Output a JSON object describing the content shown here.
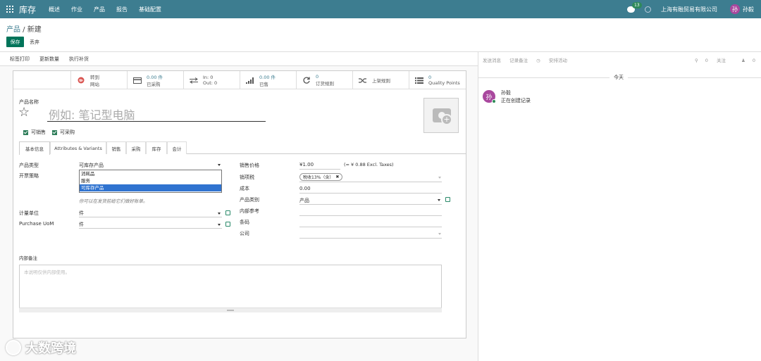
{
  "nav": {
    "brand": "库存",
    "menus": [
      "概述",
      "作业",
      "产品",
      "报告",
      "基础配置"
    ],
    "chat_badge": "13",
    "company": "上海有融贸易有限公司",
    "avatar_initial": "孙",
    "user": "孙毅"
  },
  "control": {
    "breadcrumb_parent": "产品",
    "breadcrumb_sep": " / ",
    "breadcrumb_current": "新建",
    "save": "保存",
    "discard": "丢弃"
  },
  "actions": [
    "标签打印",
    "更新数量",
    "执行补货"
  ],
  "smart_buttons": [
    {
      "line1": "转到",
      "line2": "网站",
      "icon": "globe-icon"
    },
    {
      "line1": "0.00 件",
      "line2": "已采购",
      "icon": "credit-card-icon"
    },
    {
      "line1": "In:  0",
      "line2": "Out:  0",
      "icon": "exchange-icon"
    },
    {
      "line1": "0.00 件",
      "line2": "已售",
      "icon": "signal-icon"
    },
    {
      "line1": "0",
      "line2": "订货规则",
      "icon": "refresh-icon"
    },
    {
      "line1": "上架规则",
      "line2": "",
      "icon": "random-icon"
    },
    {
      "line1": "0",
      "line2": "Quality Points",
      "icon": "list-icon"
    }
  ],
  "form": {
    "name_label": "产品名称",
    "name_placeholder": "例如: 笔记型电脑",
    "can_sell": "可销售",
    "can_purchase": "可采购",
    "tabs": [
      "基本信息",
      "Attributes & Variants",
      "销售",
      "采购",
      "库存",
      "会计"
    ],
    "product_type_label": "产品类型",
    "product_type_value": "可库存产品",
    "invoice_policy_label": "开票策略",
    "type_options": [
      "消耗品",
      "服务",
      "可库存产品"
    ],
    "invoice_hint": "你可以在发货前给它们做好账单。",
    "uom_label": "计量单位",
    "uom_value": "件",
    "purchase_uom_label": "Purchase UoM",
    "purchase_uom_value": "件",
    "sale_price_label": "销售价格",
    "sale_price_value": "¥1.00",
    "sale_price_excl": "(= ¥ 0.88 Excl. Taxes)",
    "sales_tax_label": "销项税",
    "sales_tax_tag": "税收13%（含）",
    "cost_label": "成本",
    "cost_value": "0.00",
    "category_label": "产品类别",
    "category_value": "产品",
    "internal_ref_label": "内部参考",
    "barcode_label": "条码",
    "company_label": "公司",
    "notes_label": "内部备注",
    "notes_placeholder": "本说明仅供内部使用。"
  },
  "chatter": {
    "send_message": "发送消息",
    "log_note": "记录备注",
    "schedule_activity": "安排活动",
    "attachments": "0",
    "follow": "关注",
    "followers": "0",
    "today": "今天",
    "author": "孙毅",
    "message": "正在创建记录"
  },
  "watermark": "大数跨境"
}
